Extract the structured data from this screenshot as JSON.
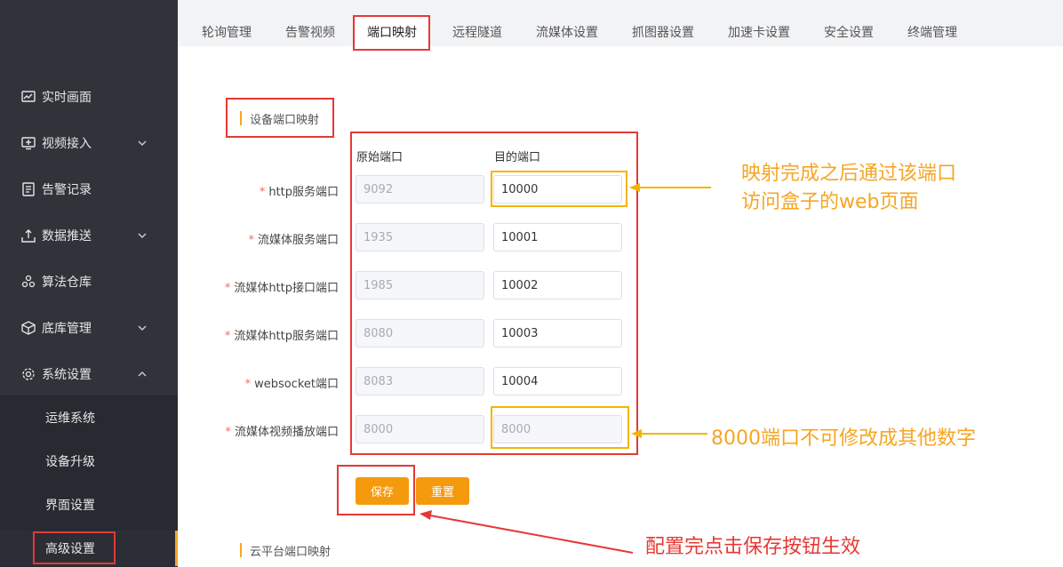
{
  "sidebar": {
    "items": [
      {
        "label": "实时画面",
        "icon": "chart-monitor-icon",
        "has_chevron": false
      },
      {
        "label": "视频接入",
        "icon": "video-screen-icon",
        "has_chevron": true
      },
      {
        "label": "告警记录",
        "icon": "document-list-icon",
        "has_chevron": false
      },
      {
        "label": "数据推送",
        "icon": "upload-tray-icon",
        "has_chevron": true
      },
      {
        "label": "算法仓库",
        "icon": "cluster-icon",
        "has_chevron": false
      },
      {
        "label": "底库管理",
        "icon": "cube-icon",
        "has_chevron": true
      },
      {
        "label": "系统设置",
        "icon": "gear-icon",
        "has_chevron": true,
        "expanded": true
      }
    ],
    "submenu": [
      {
        "label": "运维系统"
      },
      {
        "label": "设备升级"
      },
      {
        "label": "界面设置"
      },
      {
        "label": "高级设置",
        "active": true
      }
    ]
  },
  "tabs": [
    {
      "label": "轮询管理"
    },
    {
      "label": "告警视频"
    },
    {
      "label": "端口映射",
      "active": true
    },
    {
      "label": "远程隧道"
    },
    {
      "label": "流媒体设置"
    },
    {
      "label": "抓图器设置"
    },
    {
      "label": "加速卡设置"
    },
    {
      "label": "安全设置"
    },
    {
      "label": "终端管理"
    }
  ],
  "section": {
    "title": "设备端口映射"
  },
  "columns": {
    "source": "原始端口",
    "target": "目的端口"
  },
  "rows": [
    {
      "label": "http服务端口",
      "source": "9092",
      "target": "10000",
      "target_editable": true
    },
    {
      "label": "流媒体服务端口",
      "source": "1935",
      "target": "10001",
      "target_editable": true
    },
    {
      "label": "流媒体http接口端口",
      "source": "1985",
      "target": "10002",
      "target_editable": true
    },
    {
      "label": "流媒体http服务端口",
      "source": "8080",
      "target": "10003",
      "target_editable": true
    },
    {
      "label": "websocket端口",
      "source": "8083",
      "target": "10004",
      "target_editable": true
    },
    {
      "label": "流媒体视频播放端口",
      "source": "8000",
      "target": "8000",
      "target_editable": false
    }
  ],
  "required_mark": "*",
  "buttons": {
    "save": "保存",
    "reset": "重置"
  },
  "section2": {
    "title": "云平台端口映射"
  },
  "annotations": {
    "note1_line1": "映射完成之后通过该端口",
    "note1_line2": "访问盒子的web页面",
    "note2": "8000端口不可修改成其他数字",
    "note3": "配置完点击保存按钮生效"
  },
  "colors": {
    "sidebar_bg": "#30333a",
    "accent": "#f59a0c",
    "annotation_red": "#e53935",
    "annotation_yellow": "#f5b400"
  }
}
